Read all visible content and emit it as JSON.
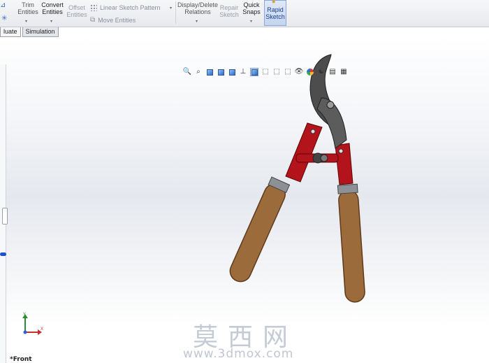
{
  "ribbon": {
    "trim": [
      "Trim",
      "Entities"
    ],
    "convert": [
      "Convert",
      "Entities"
    ],
    "offset": [
      "Offset",
      "Entities"
    ],
    "linear_pattern": "Linear Sketch Pattern",
    "move": "Move Entities",
    "display_delete": [
      "Display/Delete",
      "Relations"
    ],
    "repair": [
      "Repair",
      "Sketch"
    ],
    "quick_snaps": [
      "Quick",
      "Snaps"
    ],
    "rapid_sketch": [
      "Rapid",
      "Sketch"
    ]
  },
  "tabs": [
    "luate",
    "Simulation"
  ],
  "viewport": {
    "view_name": "*Front",
    "triad": {
      "x": "X",
      "y": "Y"
    }
  },
  "watermark": {
    "text_cn": "莫西网",
    "url": "www.3dmox.com"
  },
  "colors": {
    "handle_wood": "#9c6b3c",
    "arm_red": "#b3141b",
    "blade_metal": "#4d4d4d"
  }
}
